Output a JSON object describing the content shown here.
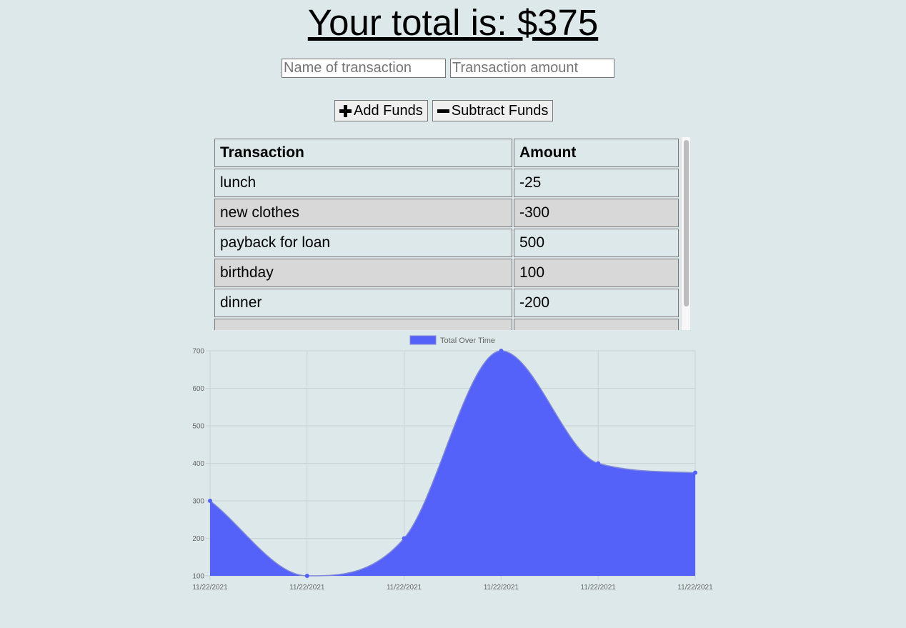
{
  "header": {
    "total_text": "Your total is: $375"
  },
  "form": {
    "name_placeholder": "Name of transaction",
    "amount_placeholder": "Transaction amount",
    "add_label": "Add Funds",
    "subtract_label": "Subtract Funds"
  },
  "table": {
    "headers": [
      "Transaction",
      "Amount"
    ],
    "rows": [
      [
        "lunch",
        "-25"
      ],
      [
        "new clothes",
        "-300"
      ],
      [
        "payback for loan",
        "500"
      ],
      [
        "birthday",
        "100"
      ],
      [
        "dinner",
        "-200"
      ],
      [
        "",
        ""
      ]
    ]
  },
  "chart_data": {
    "type": "area",
    "legend": "Total Over Time",
    "legend_position": "top-center",
    "x": [
      "11/22/2021",
      "11/22/2021",
      "11/22/2021",
      "11/22/2021",
      "11/22/2021",
      "11/22/2021"
    ],
    "series": [
      {
        "name": "Total Over Time",
        "values": [
          300,
          100,
          200,
          700,
          400,
          375
        ]
      }
    ],
    "ylim": [
      100,
      700
    ],
    "yticks": [
      100,
      200,
      300,
      400,
      500,
      600,
      700
    ],
    "grid": true,
    "colors": {
      "fill": "#5462f9",
      "line": "#5462f9",
      "grid": "#c9d2d4",
      "tick": "#666666"
    }
  }
}
